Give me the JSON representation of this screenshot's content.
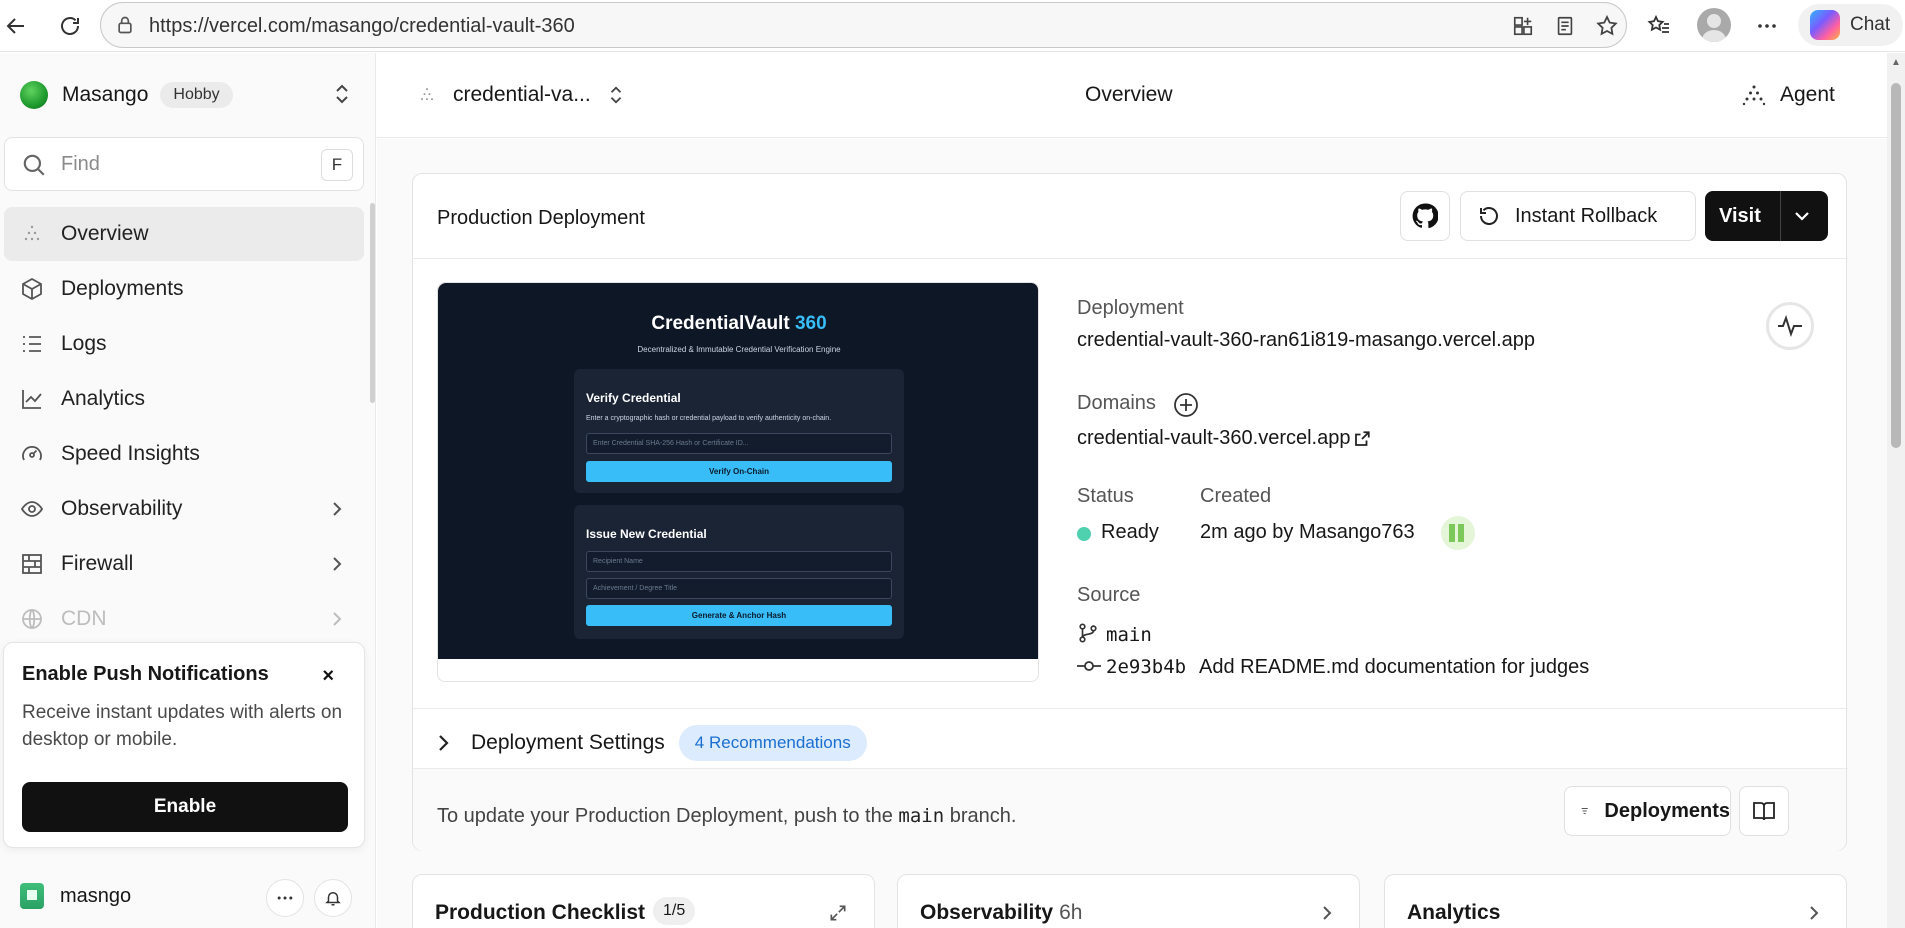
{
  "browser": {
    "url": "https://vercel.com/masango/credential-vault-360",
    "chat_label": "Chat"
  },
  "sidebar": {
    "team_name": "Masango",
    "plan_badge": "Hobby",
    "find_placeholder": "Find",
    "find_shortcut": "F",
    "items": [
      {
        "label": "Overview"
      },
      {
        "label": "Deployments"
      },
      {
        "label": "Logs"
      },
      {
        "label": "Analytics"
      },
      {
        "label": "Speed Insights"
      },
      {
        "label": "Observability"
      },
      {
        "label": "Firewall"
      },
      {
        "label": "CDN"
      }
    ],
    "push": {
      "title": "Enable Push Notifications",
      "body": "Receive instant updates with alerts on desktop or mobile.",
      "button": "Enable",
      "close": "×"
    },
    "user_name": "masngo"
  },
  "header": {
    "project": "credential-va...",
    "title": "Overview",
    "agent": "Agent"
  },
  "production": {
    "title": "Production Deployment",
    "rollback_label": "Instant Rollback",
    "visit_label": "Visit",
    "preview": {
      "title_main": "CredentialVault ",
      "title_accent": "360",
      "subtitle": "Decentralized & Immutable Credential Verification Engine",
      "verify_heading": "Verify Credential",
      "verify_text": "Enter a cryptographic hash or credential payload to verify authenticity on-chain.",
      "verify_placeholder": "Enter Credential SHA-256 Hash or Certificate ID...",
      "verify_button": "Verify On-Chain",
      "issue_heading": "Issue New Credential",
      "recipient_placeholder": "Recipient Name",
      "title_placeholder": "Achievement / Degree Title",
      "issue_button": "Generate & Anchor Hash"
    },
    "deployment_label": "Deployment",
    "deployment_url": "credential-vault-360-ran61i819-masango.vercel.app",
    "domains_label": "Domains",
    "domain": "credential-vault-360.vercel.app",
    "status_label": "Status",
    "status": "Ready",
    "created_label": "Created",
    "created": "2m ago by Masango763",
    "source_label": "Source",
    "branch": "main",
    "commit_hash": "2e93b4b",
    "commit_message": "Add README.md documentation for judges",
    "settings_label": "Deployment Settings",
    "recommendations": "4 Recommendations",
    "footer_pre": "To update your Production Deployment, push to the ",
    "footer_branch": "main",
    "footer_post": " branch.",
    "deployments_button": "Deployments"
  },
  "cards": {
    "checklist_title": "Production Checklist",
    "checklist_badge": "1/5",
    "observability_title": "Observability",
    "observability_sub": "6h",
    "analytics_title": "Analytics"
  },
  "colors": {
    "status_ready": "#4fd1b0",
    "recommendation_text": "#1a6fd1",
    "recommendation_bg": "#dcebfd",
    "preview_accent": "#38bdf8"
  }
}
